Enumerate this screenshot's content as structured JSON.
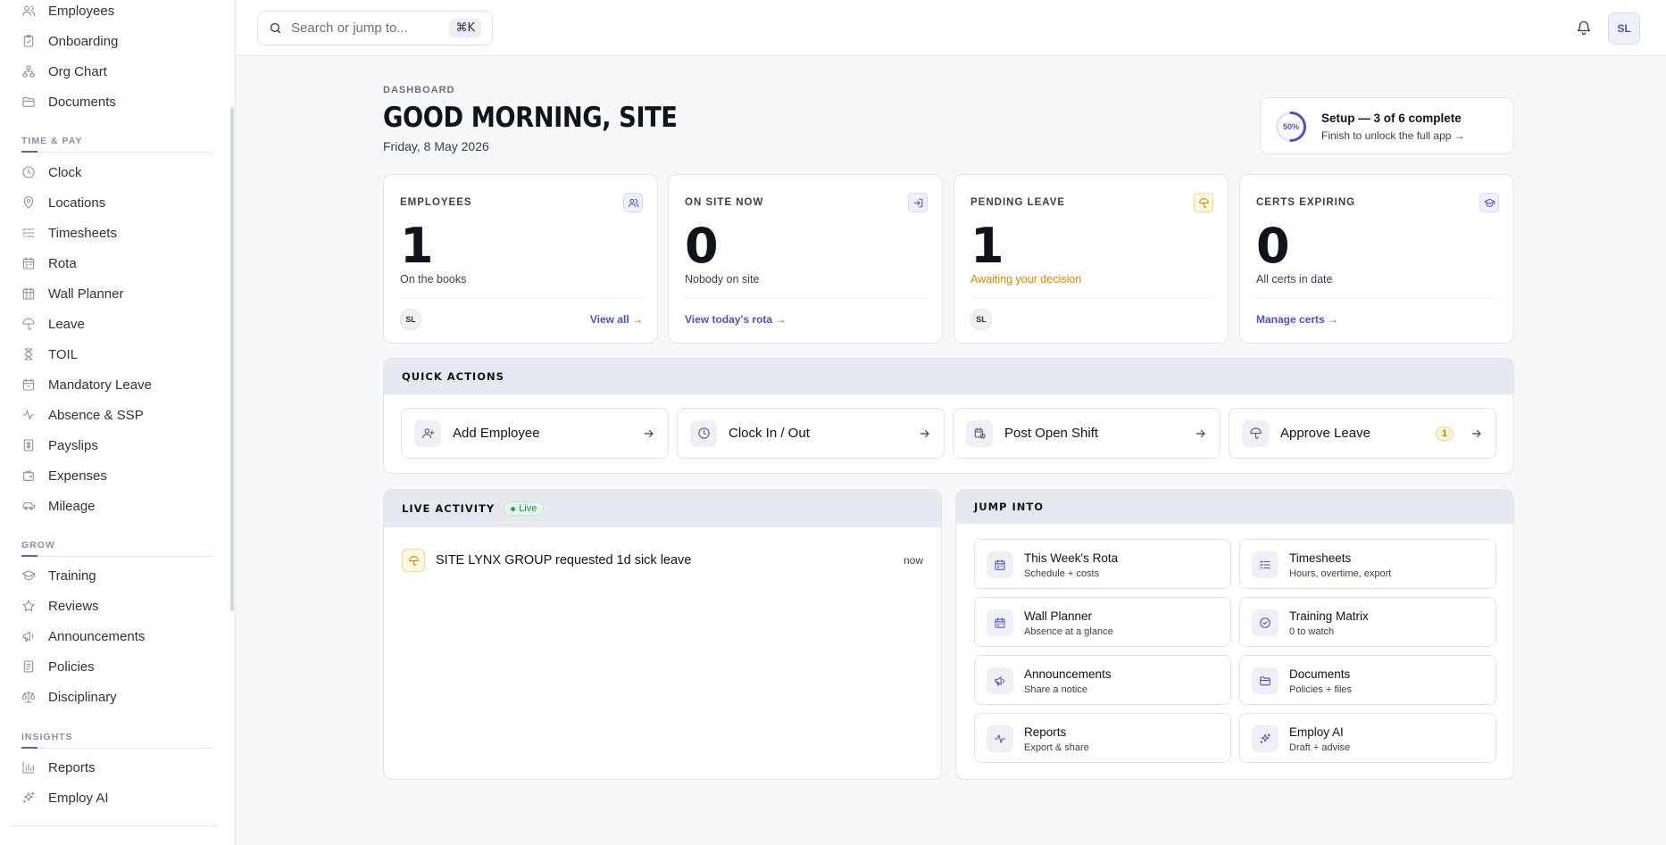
{
  "sidebar": {
    "items_top": [
      {
        "label": "Employees",
        "icon": "users-icon"
      },
      {
        "label": "Onboarding",
        "icon": "clipboard-check-icon"
      },
      {
        "label": "Org Chart",
        "icon": "org-chart-icon"
      },
      {
        "label": "Documents",
        "icon": "folder-icon"
      }
    ],
    "time_pay_label": "TIME & PAY",
    "time_pay": [
      {
        "label": "Clock",
        "icon": "clock-icon"
      },
      {
        "label": "Locations",
        "icon": "map-pin-icon"
      },
      {
        "label": "Timesheets",
        "icon": "list-check-icon"
      },
      {
        "label": "Rota",
        "icon": "calendar-icon"
      },
      {
        "label": "Wall Planner",
        "icon": "calendar-grid-icon"
      },
      {
        "label": "Leave",
        "icon": "umbrella-icon"
      },
      {
        "label": "TOIL",
        "icon": "hourglass-icon"
      },
      {
        "label": "Mandatory Leave",
        "icon": "calendar-lock-icon"
      },
      {
        "label": "Absence & SSP",
        "icon": "activity-icon"
      },
      {
        "label": "Payslips",
        "icon": "receipt-icon"
      },
      {
        "label": "Expenses",
        "icon": "wallet-icon"
      },
      {
        "label": "Mileage",
        "icon": "car-icon"
      }
    ],
    "grow_label": "GROW",
    "grow": [
      {
        "label": "Training",
        "icon": "graduation-cap-icon"
      },
      {
        "label": "Reviews",
        "icon": "star-icon"
      },
      {
        "label": "Announcements",
        "icon": "megaphone-icon"
      },
      {
        "label": "Policies",
        "icon": "document-icon"
      },
      {
        "label": "Disciplinary",
        "icon": "scales-icon"
      }
    ],
    "insights_label": "INSIGHTS",
    "insights": [
      {
        "label": "Reports",
        "icon": "bar-chart-icon"
      },
      {
        "label": "Employ AI",
        "icon": "sparkles-icon"
      }
    ]
  },
  "topbar": {
    "search_placeholder": "Search or jump to...",
    "shortcut": "⌘K",
    "avatar_initials": "SL"
  },
  "header": {
    "eyebrow": "DASHBOARD",
    "greeting": "GOOD MORNING, SITE",
    "date": "Friday, 8 May 2026"
  },
  "setup": {
    "percent_label": "50%",
    "progress_fraction": 0.5,
    "title": "Setup — 3 of 6 complete",
    "subtitle": "Finish to unlock the full app →"
  },
  "stats": [
    {
      "label": "EMPLOYEES",
      "value": "1",
      "sub": "On the books",
      "avatar": "SL",
      "link": "View all →",
      "icon": "users-icon",
      "accent": "#4b55b8"
    },
    {
      "label": "ON SITE NOW",
      "value": "0",
      "sub": "Nobody on site",
      "avatar": "",
      "link": "View today's rota →",
      "icon": "sign-in-icon",
      "accent": "#4b55b8"
    },
    {
      "label": "PENDING LEAVE",
      "value": "1",
      "sub": "Awaiting your decision",
      "avatar": "SL",
      "link": "",
      "icon": "umbrella-icon",
      "accent": "#d08a00"
    },
    {
      "label": "CERTS EXPIRING",
      "value": "0",
      "sub": "All certs in date",
      "avatar": "",
      "link": "Manage certs →",
      "icon": "graduation-cap-icon",
      "accent": "#4b55b8"
    }
  ],
  "quick_actions": {
    "title": "QUICK ACTIONS",
    "items": [
      {
        "label": "Add Employee",
        "icon": "user-plus-icon",
        "badge": ""
      },
      {
        "label": "Clock In / Out",
        "icon": "clock-icon",
        "badge": ""
      },
      {
        "label": "Post Open Shift",
        "icon": "calendar-clock-icon",
        "badge": ""
      },
      {
        "label": "Approve Leave",
        "icon": "umbrella-icon",
        "badge": "1"
      }
    ]
  },
  "live_activity": {
    "title": "LIVE ACTIVITY",
    "pill": "Live",
    "items": [
      {
        "text": "SITE LYNX GROUP requested 1d sick leave",
        "time": "now",
        "icon": "umbrella-icon"
      }
    ]
  },
  "jump_into": {
    "title": "JUMP INTO",
    "items": [
      {
        "title": "This Week's Rota",
        "sub": "Schedule + costs",
        "icon": "calendar-icon"
      },
      {
        "title": "Timesheets",
        "sub": "Hours, overtime, export",
        "icon": "list-check-icon"
      },
      {
        "title": "Wall Planner",
        "sub": "Absence at a glance",
        "icon": "calendar-icon"
      },
      {
        "title": "Training Matrix",
        "sub": "0 to watch",
        "icon": "check-circle-icon"
      },
      {
        "title": "Announcements",
        "sub": "Share a notice",
        "icon": "megaphone-icon"
      },
      {
        "title": "Documents",
        "sub": "Policies + files",
        "icon": "folder-icon"
      },
      {
        "title": "Reports",
        "sub": "Export & share",
        "icon": "activity-icon"
      },
      {
        "title": "Employ AI",
        "sub": "Draft + advise",
        "icon": "sparkles-icon"
      }
    ]
  }
}
